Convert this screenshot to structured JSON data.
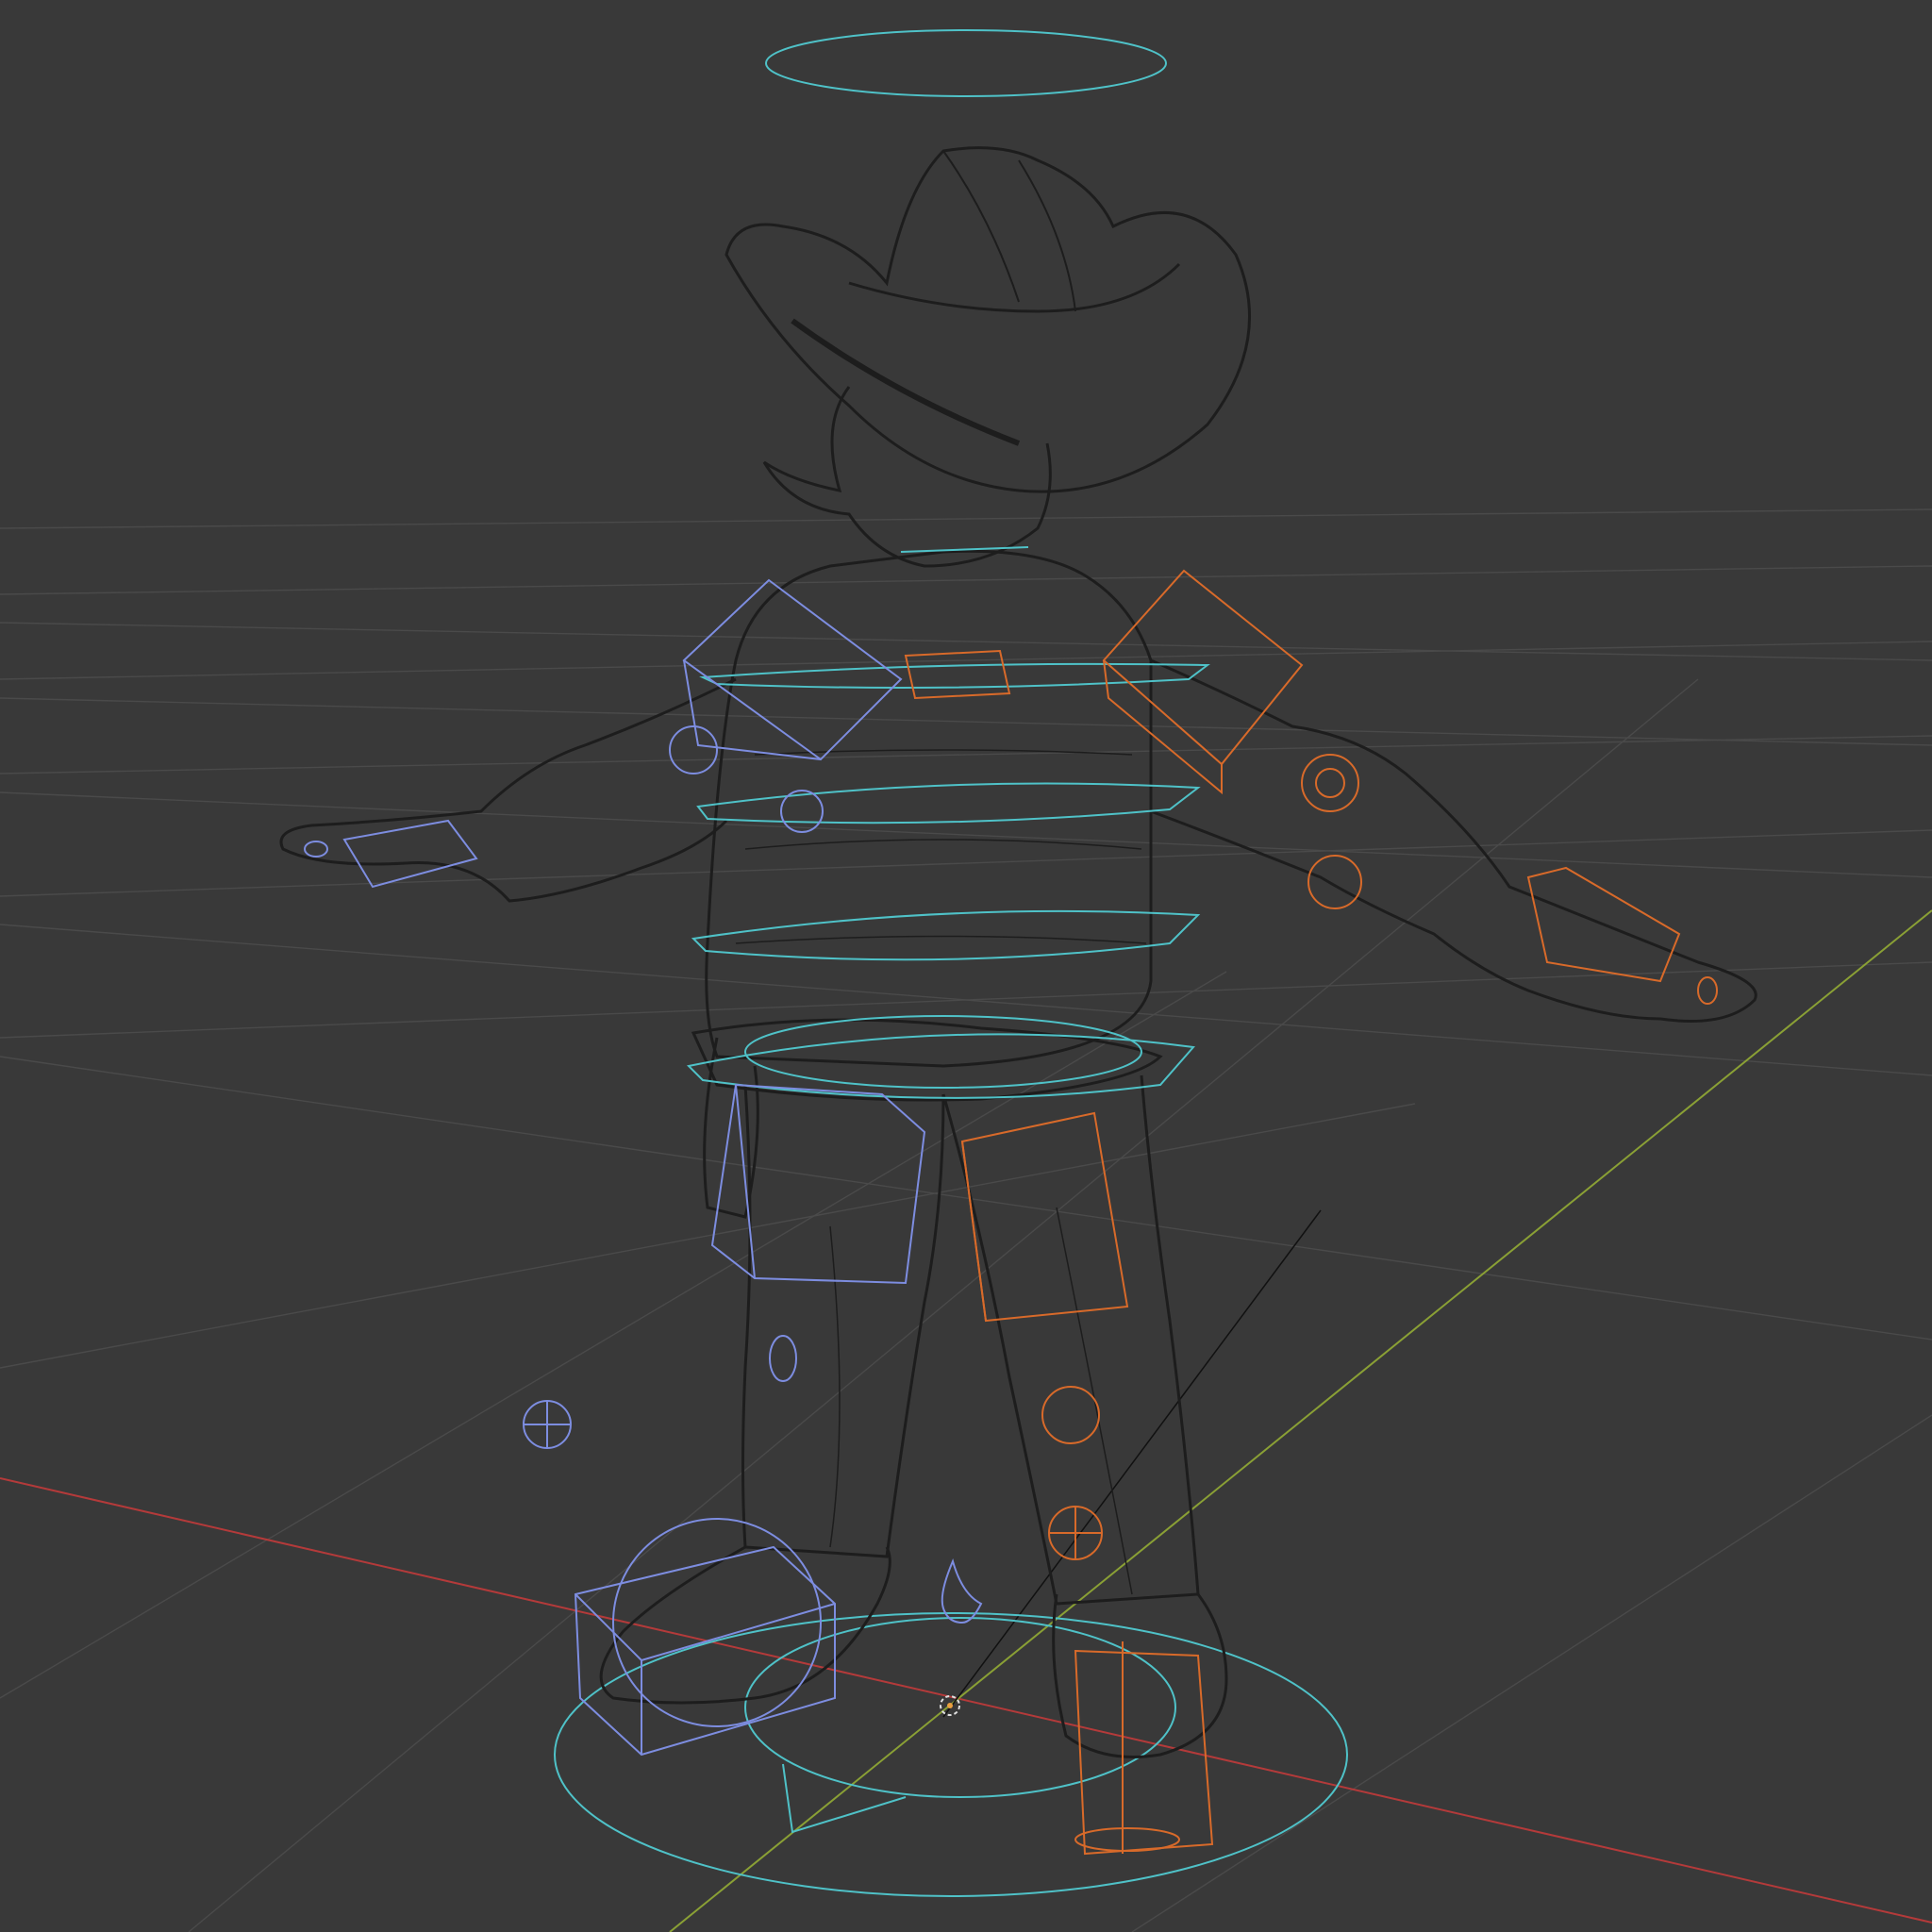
{
  "viewport": {
    "mode": "wireframe",
    "object": "cowboy-character-mesh",
    "colors": {
      "background": "#393939",
      "grid": "#4a4a4a",
      "x_axis": "#b43a3a",
      "y_axis": "#8aa035",
      "mesh_wire": "#1d1d1d",
      "control_cyan": "#4fc2c8",
      "control_left": "#7d8de0",
      "control_right": "#d86a2a"
    }
  }
}
